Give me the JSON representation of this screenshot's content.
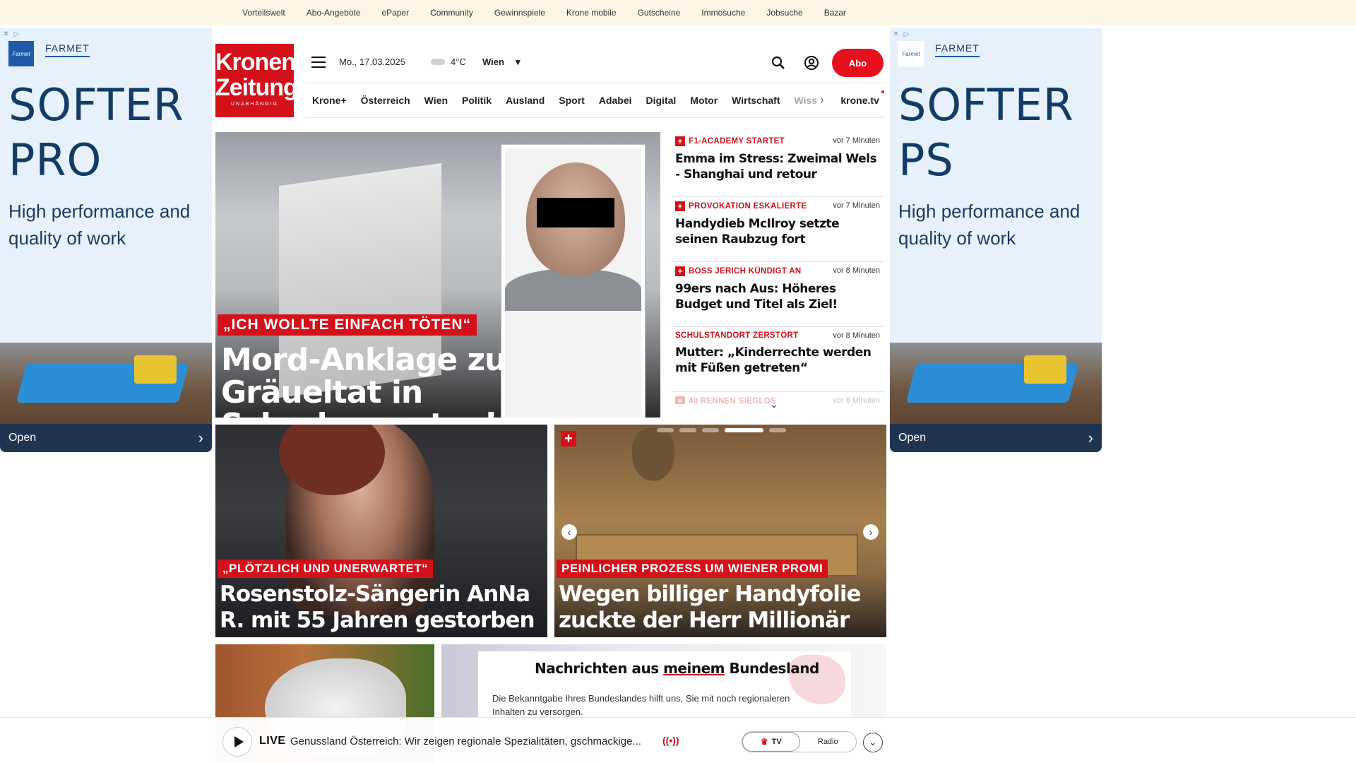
{
  "topbar": {
    "links": [
      "Vorteilswelt",
      "Abo-Angebote",
      "ePaper",
      "Community",
      "Gewinnspiele",
      "Krone mobile",
      "Gutscheine",
      "Immosuche",
      "Jobsuche",
      "Bazar"
    ]
  },
  "ad_left": {
    "brand": "FARMET",
    "logo_text": "Farmet",
    "headline_1": "SOFTER",
    "headline_2": "PRO",
    "sub": "High performance and quality of work",
    "cta": "Open"
  },
  "ad_right": {
    "brand": "FARMET",
    "logo_text": "Farmet",
    "headline_1": "SOFTER",
    "headline_2": "PS",
    "sub": "High performance and quality of work",
    "cta": "Open"
  },
  "header": {
    "logo_line1": "Kronen",
    "logo_line2": "Zeitung",
    "logo_line3": "UNABHÄNGIG",
    "date": "Mo., 17.03.2025",
    "temperature": "4°C",
    "city": "Wien",
    "abo": "Abo"
  },
  "nav": {
    "items": [
      "Krone+",
      "Österreich",
      "Wien",
      "Politik",
      "Ausland",
      "Sport",
      "Adabei",
      "Digital",
      "Motor",
      "Wirtschaft"
    ],
    "faded_item": "Wiss",
    "tv": "krone.tv"
  },
  "hero": {
    "kicker": "„ICH WOLLTE EINFACH TÖTEN“",
    "title": "Mord-Anklage zu Gräueltat in Schrebergartenhaus fertig"
  },
  "news": [
    {
      "category": "F1-ACADEMY STARTET",
      "time": "vor 7 Minuten",
      "headline": "Emma im Stress: Zweimal Wels - Shanghai und retour",
      "plus": true
    },
    {
      "category": "PROVOKATION ESKALIERTE",
      "time": "vor 7 Minuten",
      "headline": "Handydieb McIlroy setzte seinen Raubzug fort",
      "plus": true
    },
    {
      "category": "BOSS JERICH KÜNDIGT AN",
      "time": "vor 8 Minuten",
      "headline": "99ers nach Aus: Höheres Budget und Titel als Ziel!",
      "plus": true
    },
    {
      "category": "SCHULSTANDORT ZERSTÖRT",
      "time": "vor 8 Minuten",
      "headline": "Mutter: „Kinderrechte werden mit Füßen getreten“",
      "plus": false
    },
    {
      "category": "40 RENNEN SIEGLOS",
      "time": "vor 8 Minuten",
      "headline": "",
      "plus": true
    }
  ],
  "card_left": {
    "kicker": "„PLÖTZLICH UND UNERWARTET“",
    "title": "Rosenstolz-Sängerin AnNa R. mit 55 Jahren gestorben"
  },
  "card_right": {
    "kicker": "PEINLICHER PROZESS UM WIENER PROMI",
    "title": "Wegen billiger Handyfolie zuckte der Herr Millionär aus"
  },
  "bundesland": {
    "title_pre": "Nachrichten aus ",
    "title_u": "meinem",
    "title_post": " Bundesland",
    "desc": "Die Bekanntgabe Ihres Bundeslandes hilft uns, Sie mit noch regionaleren Inhalten zu versorgen."
  },
  "livebar": {
    "label": "LIVE",
    "text": "Genussland Österreich: Wir zeigen regionale Spezialitäten, gschmackige...",
    "signal": "((•))",
    "tv": "TV",
    "radio": "Radio"
  },
  "colors": {
    "brand_red": "#d4101a",
    "abo_red": "#e5101c",
    "topbar_bg": "#fbf6e4",
    "ad_bg": "#e6f1fb",
    "ad_text": "#123b66"
  }
}
